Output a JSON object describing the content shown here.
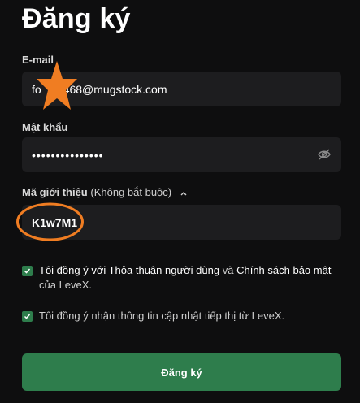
{
  "page": {
    "title": "Đăng ký"
  },
  "email": {
    "label": "E-mail",
    "value_start": "fo",
    "value_end": "468@mugstock.com"
  },
  "password": {
    "label": "Mật khẩu",
    "masked_value": "•••••••••••••••",
    "toggle_icon": "eye-slash-icon"
  },
  "referral": {
    "label": "Mã giới thiệu",
    "optional": "(Không bắt buộc)",
    "value": "K1w7M1"
  },
  "consent": {
    "terms_link": "Tôi đồng ý với Thỏa thuận người dùng",
    "terms_and": "và",
    "privacy_link": "Chính sách bảo mật",
    "terms_tail": "của LeveX.",
    "marketing_text": "Tôi đồng ý nhận thông tin cập nhật tiếp thị từ LeveX."
  },
  "submit": {
    "label": "Đăng ký"
  },
  "colors": {
    "background": "#0e0e0f",
    "field": "#1d1d1f",
    "accent": "#2e7d4c",
    "annotation": "#f07d22"
  }
}
